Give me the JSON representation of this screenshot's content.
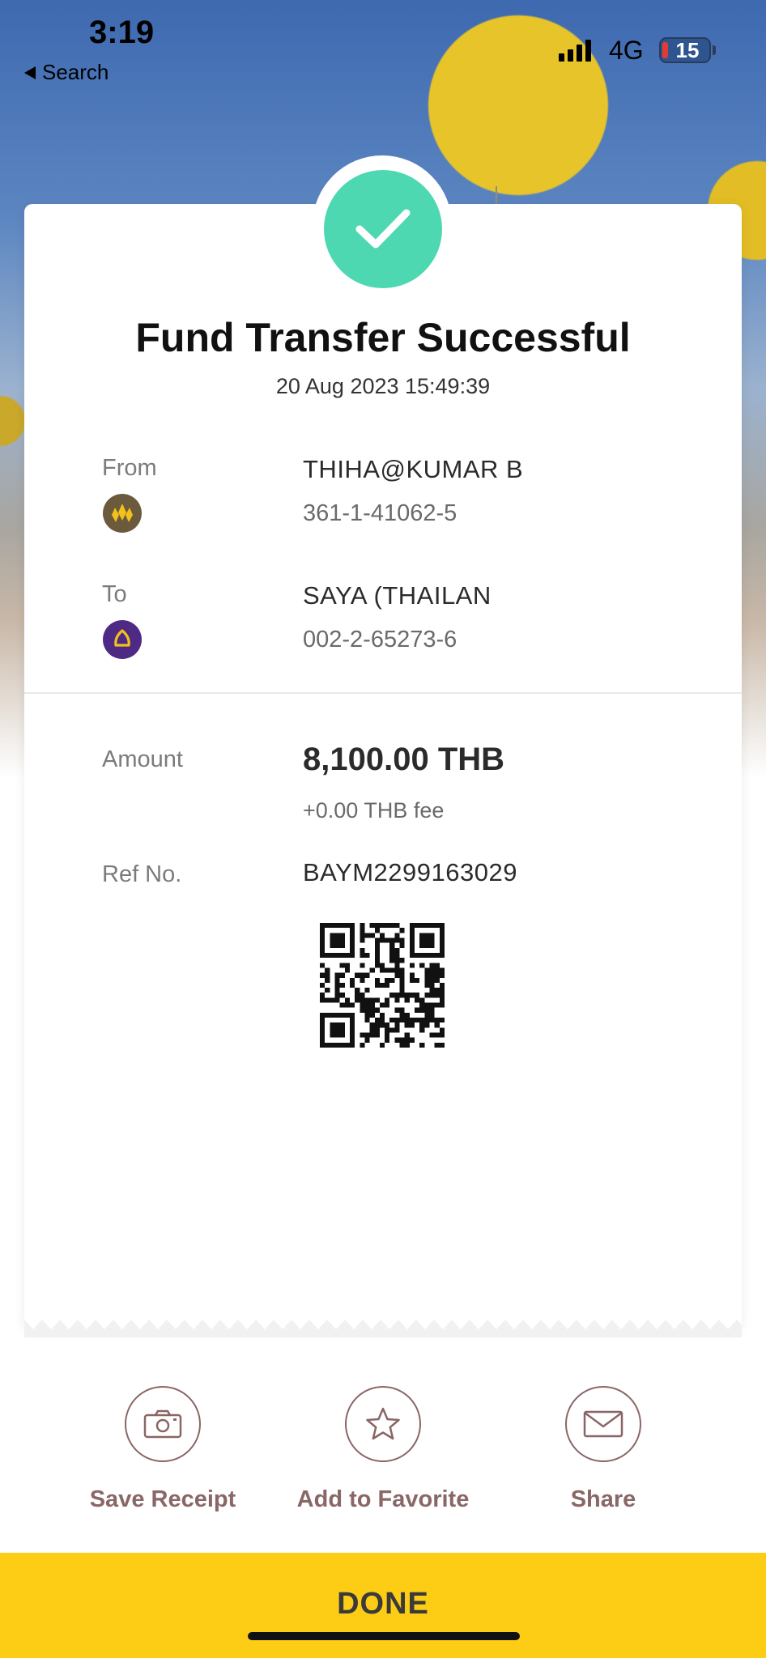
{
  "status_bar": {
    "time": "3:19",
    "back_label": "Search",
    "network": "4G",
    "battery": "15"
  },
  "receipt": {
    "title": "Fund Transfer Successful",
    "datetime": "20 Aug 2023 15:49:39",
    "from": {
      "label": "From",
      "name": "THIHA@KUMAR B",
      "account": "361-1-41062-5",
      "bank_icon": "krungsri-bank-icon",
      "bank_color": "#6b5a3c"
    },
    "to": {
      "label": "To",
      "name": "SAYA (THAILAN",
      "account": "002-2-65273-6",
      "bank_icon": "scb-bank-icon",
      "bank_color": "#4e2a84"
    },
    "amount_label": "Amount",
    "amount": "8,100.00 THB",
    "fee": "+0.00 THB fee",
    "ref_label": "Ref No.",
    "ref_no": "BAYM2299163029"
  },
  "actions": [
    {
      "label": "Save Receipt",
      "icon": "camera-icon"
    },
    {
      "label": "Add to Favorite",
      "icon": "star-icon"
    },
    {
      "label": "Share",
      "icon": "envelope-icon"
    }
  ],
  "done_label": "DONE",
  "colors": {
    "success": "#4ed8b1",
    "action_text": "#8a6767",
    "done_bar": "#fccd14"
  }
}
